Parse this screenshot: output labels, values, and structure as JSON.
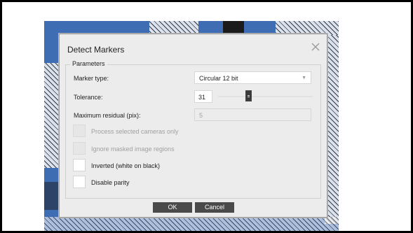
{
  "dialog": {
    "title": "Detect Markers",
    "close_icon": "close-icon",
    "group_label": "Parameters",
    "marker_type": {
      "label": "Marker type:",
      "value": "Circular 12 bit"
    },
    "tolerance": {
      "label": "Tolerance:",
      "value": "31",
      "slider_fraction": 0.31
    },
    "max_residual": {
      "label": "Maximum residual (pix):",
      "value": "5"
    },
    "checkboxes": [
      {
        "label": "Process selected cameras only",
        "enabled": false,
        "checked": false
      },
      {
        "label": "Ignore masked image regions",
        "enabled": false,
        "checked": false
      },
      {
        "label": "Inverted (white on black)",
        "enabled": true,
        "checked": false
      },
      {
        "label": "Disable parity",
        "enabled": true,
        "checked": false
      }
    ],
    "ok_label": "OK",
    "cancel_label": "Cancel"
  },
  "colors": {
    "background_image": "#3f6db4",
    "button": "#4a4a4a",
    "dialog": "#ececec"
  }
}
